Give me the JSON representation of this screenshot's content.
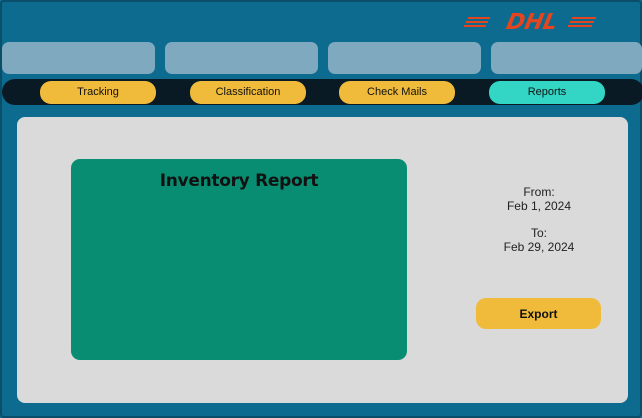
{
  "brand": {
    "logo_text": "DHL",
    "logo_color": "#e4451f",
    "icon": "dhl-logo"
  },
  "topbar": {
    "slots": [
      "",
      "",
      "",
      ""
    ]
  },
  "nav": {
    "tabs": [
      {
        "label": "Tracking",
        "active": false
      },
      {
        "label": "Classification",
        "active": false
      },
      {
        "label": "Check Mails",
        "active": false
      },
      {
        "label": "Reports",
        "active": true
      }
    ]
  },
  "report": {
    "title": "Inventory Report",
    "from_label": "From:",
    "from_value": "Feb 1, 2024",
    "to_label": "To:",
    "to_value": "Feb 29, 2024",
    "export_label": "Export"
  },
  "colors": {
    "background": "#0c6b8f",
    "tab": "#f0bb3a",
    "tab_active": "#33d6c4",
    "card": "#088d72",
    "panel": "#dadada"
  }
}
